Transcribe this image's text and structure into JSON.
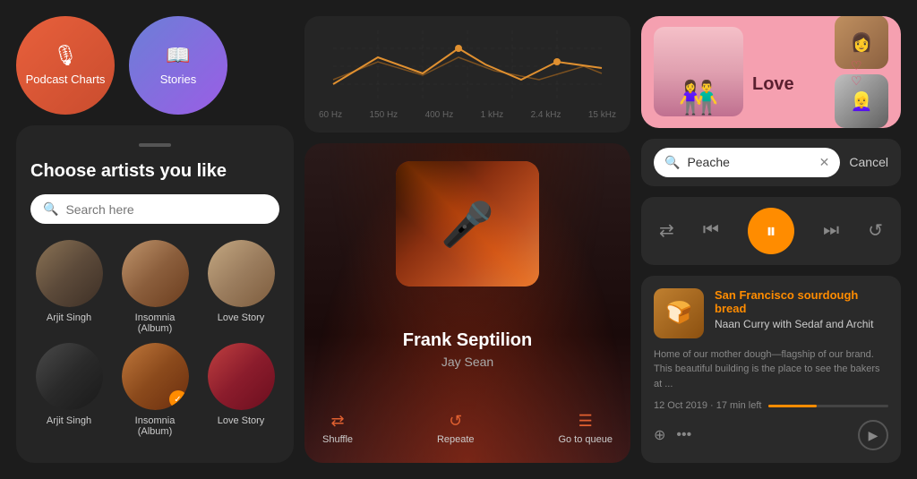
{
  "circles": [
    {
      "id": "podcast-charts",
      "label": "Podcast\nCharts",
      "icon": "🎙",
      "color": "podcast"
    },
    {
      "id": "stories",
      "label": "Stories",
      "icon": "📖",
      "color": "stories"
    }
  ],
  "artist_selector": {
    "drag_handle": true,
    "title": "Choose artists you like",
    "search_placeholder": "Search here",
    "artists": [
      {
        "name": "Arjit Singh",
        "gradient": "avatar-gradient-1",
        "checked": false
      },
      {
        "name": "Insomnia (Album)",
        "gradient": "avatar-gradient-2",
        "checked": false
      },
      {
        "name": "Love Story",
        "gradient": "avatar-gradient-3",
        "checked": false
      },
      {
        "name": "Arjit Singh",
        "gradient": "avatar-gradient-4",
        "checked": false
      },
      {
        "name": "Insomnia (Album)",
        "gradient": "avatar-gradient-5",
        "checked": true
      },
      {
        "name": "Love Story",
        "gradient": "avatar-gradient-6",
        "checked": false
      }
    ]
  },
  "equalizer": {
    "labels": [
      "60 Hz",
      "150 Hz",
      "400 Hz",
      "1 kHz",
      "2.4 kHz",
      "15 kHz"
    ]
  },
  "player": {
    "artist": "Frank Septilion",
    "song": "Jay Sean",
    "controls": [
      {
        "id": "shuffle",
        "icon": "⇄",
        "label": "Shuffle"
      },
      {
        "id": "repeat",
        "icon": "↺",
        "label": "Repeate"
      },
      {
        "id": "queue",
        "icon": "☰",
        "label": "Go to queue"
      }
    ]
  },
  "love_card": {
    "title": "Love",
    "hearts": "♡ ♡"
  },
  "search": {
    "value": "Peache",
    "cancel_label": "Cancel"
  },
  "playback": {
    "shuffle_icon": "⇄",
    "rewind_icon": "⏮",
    "play_icon": "⏸",
    "forward_icon": "⏭",
    "repeat_icon": "↺"
  },
  "podcast": {
    "title": "San Francisco sourdough bread",
    "subtitle": "Naan Curry with Sedaf and Archit",
    "description": "Home of our mother dough—flagship of our brand. This beautiful building is the place to see the bakers at ...",
    "date": "12 Oct 2019 · 17 min left",
    "progress": 40
  }
}
